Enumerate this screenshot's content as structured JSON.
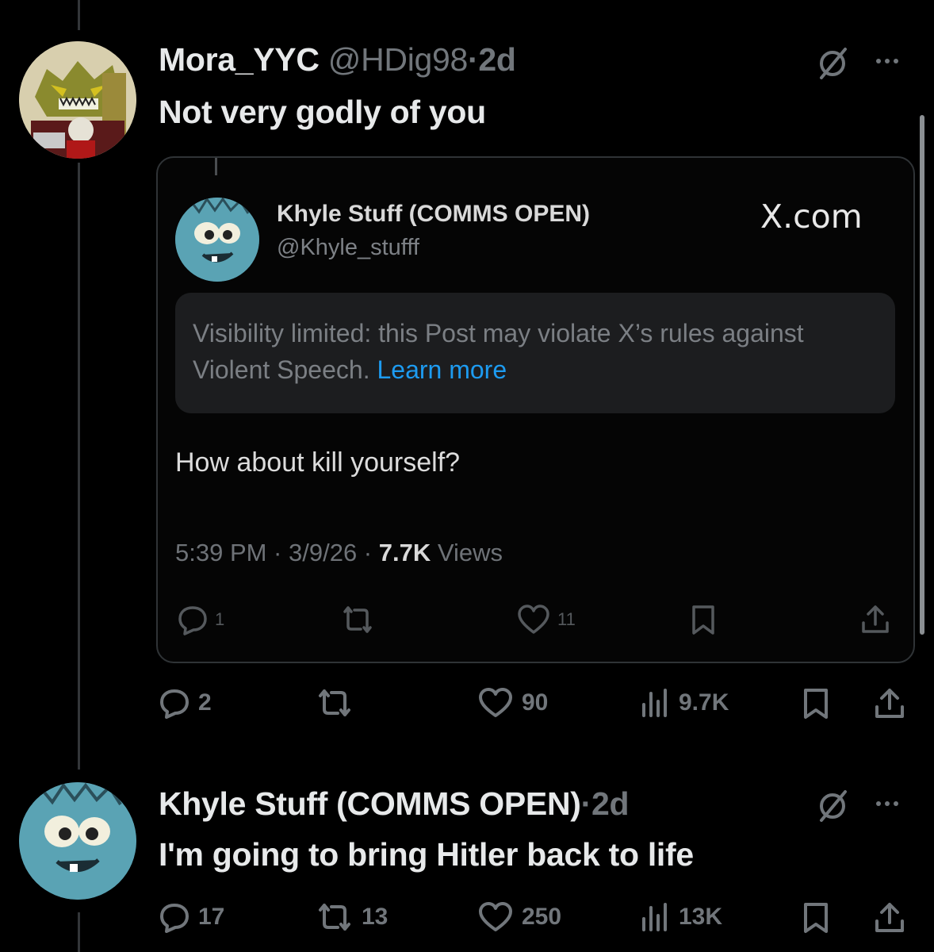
{
  "post1": {
    "display_name": "Mora_YYC",
    "handle": "@HDig98",
    "separator": "·",
    "time": "2d",
    "text": "Not very godly of you",
    "stats": {
      "replies": "2",
      "likes": "90",
      "views": "9.7K"
    }
  },
  "embed": {
    "display_name": "Khyle Stuff (COMMS OPEN)",
    "handle": "@Khyle_stufff",
    "site_logo": "X.com",
    "notice_text": "Visibility limited: this Post may violate X’s rules against Violent Speech.",
    "notice_link": "Learn more",
    "body": "How about kill yourself?",
    "meta_time": "5:39 PM · 3/9/26 · ",
    "meta_views_count": "7.7K",
    "meta_views_label": " Views",
    "stats": {
      "replies": "1",
      "likes": "11"
    }
  },
  "post2": {
    "display_name": "Khyle Stuff (COMMS OPEN)",
    "separator": "·",
    "time": "2d",
    "text": "I'm going to bring Hitler back to life",
    "stats": {
      "replies": "17",
      "reposts": "13",
      "likes": "250",
      "views": "13K"
    }
  },
  "icons": {
    "reply": "reply-icon",
    "repost": "repost-icon",
    "like": "heart-icon",
    "views": "views-icon",
    "bookmark": "bookmark-icon",
    "share": "share-icon",
    "grok": "grok-icon",
    "more": "more-icon"
  },
  "colors": {
    "background": "#000000",
    "text_primary": "#e7e9ea",
    "text_secondary": "#71767b",
    "link": "#1d9bf0",
    "border": "#2f3336"
  }
}
